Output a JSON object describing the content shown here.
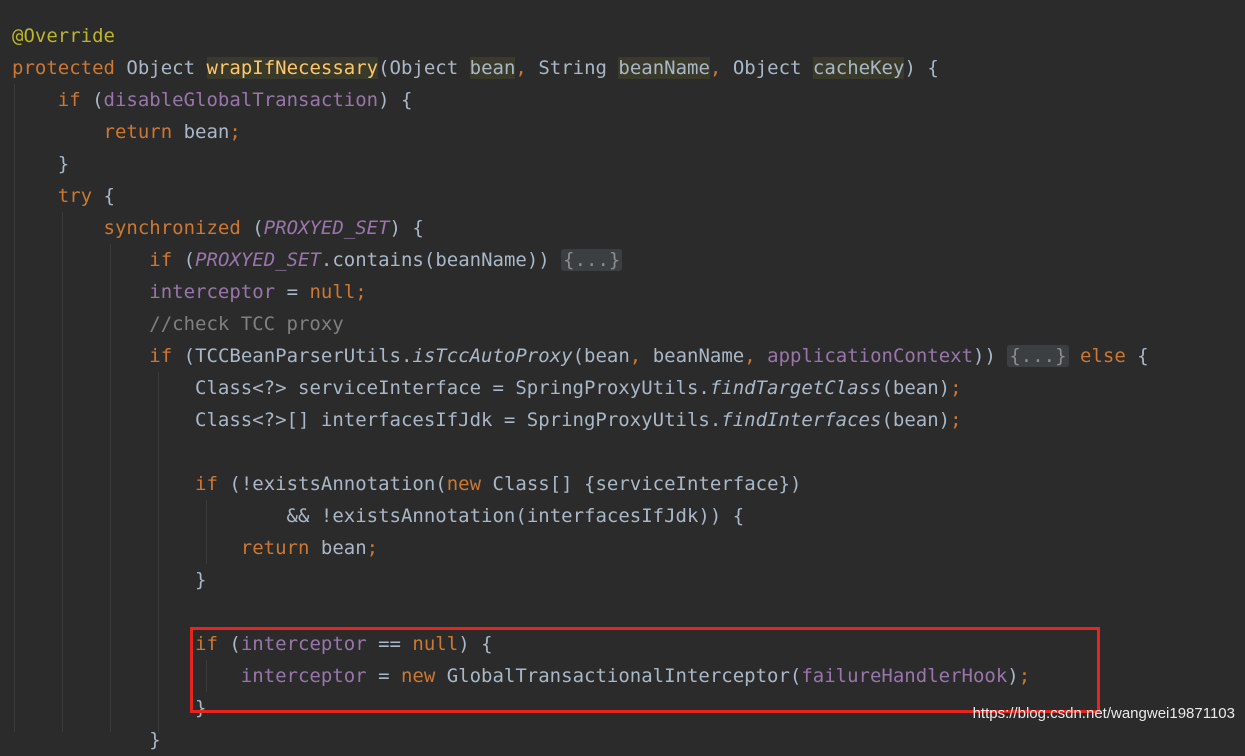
{
  "code": {
    "annotation": "@Override",
    "m_protected": "protected",
    "m_ret": "Object",
    "m_name": "wrapIfNecessary",
    "m_p1_type": "Object",
    "m_p1": "bean",
    "m_p2_type": "String",
    "m_p2": "beanName",
    "m_p3_type": "Object",
    "m_p3": "cacheKey",
    "kw_if": "if",
    "kw_return": "return",
    "kw_try": "try",
    "kw_sync": "synchronized",
    "kw_null": "null",
    "kw_new": "new",
    "kw_else": "else",
    "f_disable": "disableGlobalTransaction",
    "v_bean": "bean",
    "v_beanName": "beanName",
    "f_proxyed": "PROXYED_SET",
    "m_contains": "contains",
    "fold": "{...}",
    "f_interceptor": "interceptor",
    "comment": "//check TCC proxy",
    "c_tccutils": "TCCBeanParserUtils",
    "m_istcc": "isTccAutoProxy",
    "f_appctx": "applicationContext",
    "t_class_q": "Class<?>",
    "v_serviceInterface": "serviceInterface",
    "c_springproxy": "SpringProxyUtils",
    "m_findtarget": "findTargetClass",
    "t_class_arr": "Class<?>[]",
    "v_ifaces": "interfacesIfJdk",
    "m_findifaces": "findInterfaces",
    "m_exists": "!existsAnnotation",
    "t_class_arr2": "Class[]",
    "and_op": "&&",
    "c_gti": "GlobalTransactionalInterceptor",
    "f_failure": "failureHandlerHook"
  },
  "watermark": "https://blog.csdn.net/wangwei19871103",
  "highlight_color": "#e8251d"
}
